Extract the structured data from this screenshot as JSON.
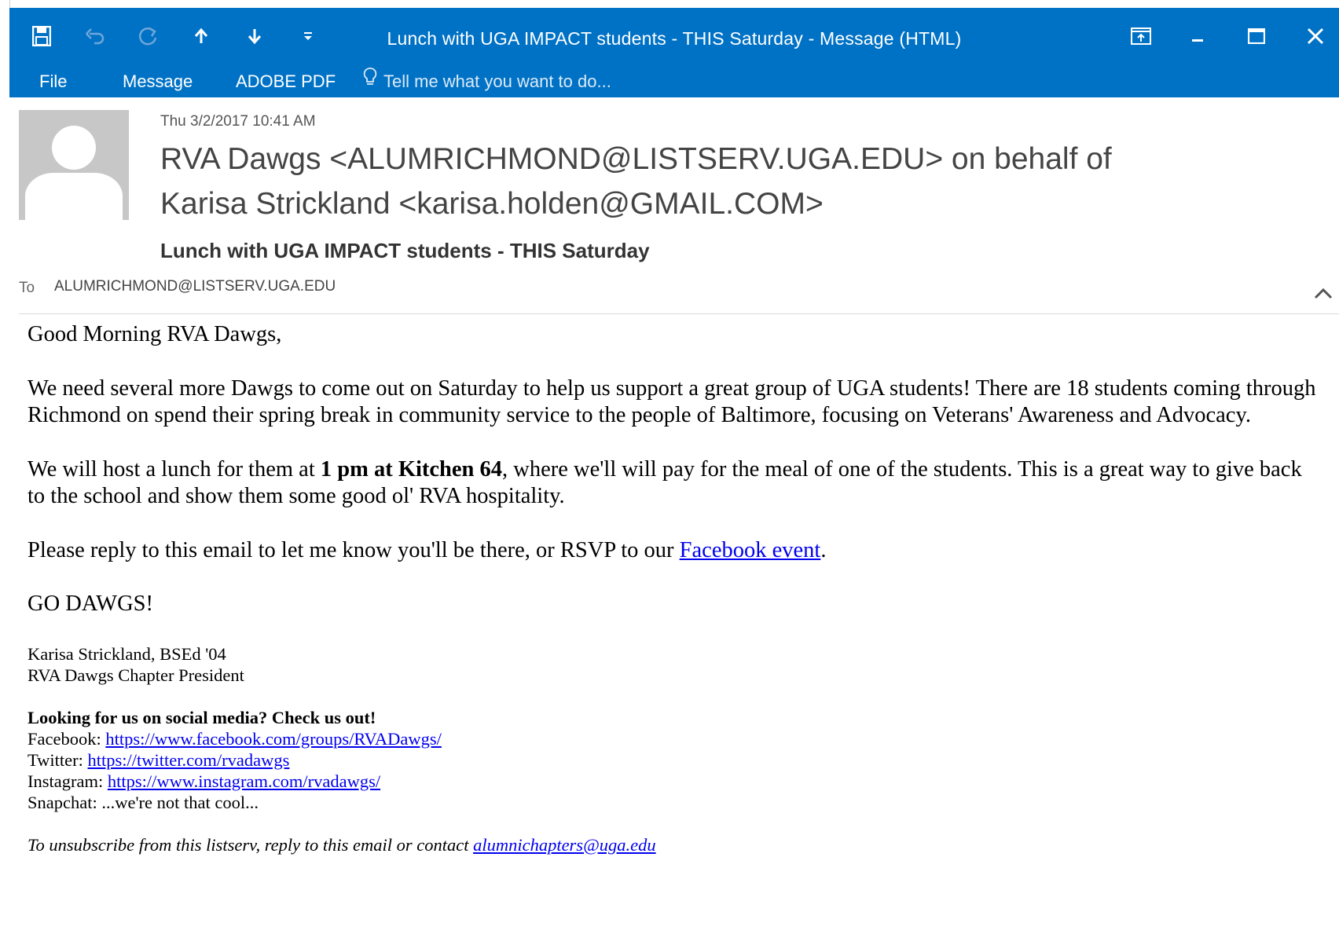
{
  "window": {
    "title": "Lunch with UGA IMPACT students - THIS Saturday - Message (HTML)"
  },
  "ribbon": {
    "tabs": [
      {
        "label": "File"
      },
      {
        "label": "Message"
      },
      {
        "label": "ADOBE PDF"
      }
    ],
    "tell_me": "Tell me what you want to do..."
  },
  "header": {
    "date": "Thu 3/2/2017 10:41 AM",
    "sender_line1": "RVA Dawgs <ALUMRICHMOND@LISTSERV.UGA.EDU> on behalf of",
    "sender_line2": "Karisa Strickland <karisa.holden@GMAIL.COM>",
    "subject": "Lunch with UGA IMPACT students - THIS Saturday",
    "to_label": "To",
    "to_value": "ALUMRICHMOND@LISTSERV.UGA.EDU"
  },
  "body": {
    "greeting": "Good Morning RVA Dawgs,",
    "p1": "We need several more Dawgs to come out on Saturday to help us support a great group of UGA students! There are 18 students coming through Richmond on spend their spring break in community service to the people of Baltimore, focusing on Veterans' Awareness and Advocacy.",
    "p2_pre": "We will host a lunch for them at ",
    "p2_bold": "1 pm at Kitchen 64",
    "p2_post": ", where we'll will pay for the meal of one of the students. This is a great way to give back to the school and show them some good ol' RVA hospitality.",
    "p3_pre": "Please reply to this email to let me know you'll be there, or RSVP to our ",
    "p3_link": "Facebook event",
    "p3_post": ".",
    "cheer": "GO DAWGS!",
    "sig_name": "Karisa Strickland, BSEd '04",
    "sig_title": "RVA Dawgs Chapter President",
    "social_heading": "Looking for us on social media? Check us out!",
    "facebook_label": "Facebook: ",
    "facebook_url": "https://www.facebook.com/groups/RVADawgs/",
    "twitter_label": "Twitter: ",
    "twitter_url": "https://twitter.com/rvadawgs",
    "instagram_label": "Instagram: ",
    "instagram_url": "https://www.instagram.com/rvadawgs/",
    "snapchat": "Snapchat: ...we're not that cool...",
    "unsub_pre": "To unsubscribe from this listserv, reply to this email or contact ",
    "unsub_email": "alumnichapters@uga.edu"
  },
  "colors": {
    "titlebar": "#0072c6",
    "link": "#0000ee",
    "avatar_bg": "#c7c7c7"
  },
  "icons": [
    "save-icon",
    "undo-icon",
    "redo-icon",
    "previous-item-icon",
    "next-item-icon",
    "customize-qat-icon",
    "restore-window-icon",
    "minimize-icon",
    "maximize-icon",
    "close-icon",
    "lightbulb-icon",
    "collapse-header-icon",
    "avatar-placeholder-icon"
  ]
}
